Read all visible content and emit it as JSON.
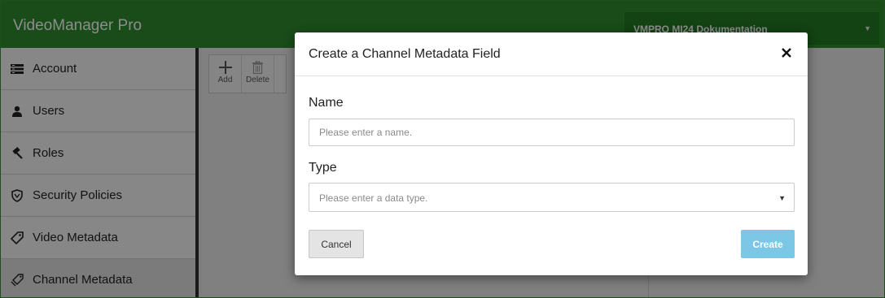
{
  "header": {
    "app_title": "VideoManager Pro",
    "project_selector": "VMPRO MI24 Dokumentation"
  },
  "sidebar": {
    "items": [
      {
        "label": "Account",
        "icon": "list-icon"
      },
      {
        "label": "Users",
        "icon": "user-icon"
      },
      {
        "label": "Roles",
        "icon": "gavel-icon"
      },
      {
        "label": "Security Policies",
        "icon": "shield-icon"
      },
      {
        "label": "Video Metadata",
        "icon": "tag-icon"
      },
      {
        "label": "Channel Metadata",
        "icon": "tags-icon"
      }
    ],
    "active_index": 5
  },
  "toolbar": {
    "add_label": "Add",
    "delete_label": "Delete"
  },
  "modal": {
    "title": "Create a Channel Metadata Field",
    "name_label": "Name",
    "name_placeholder": "Please enter a name.",
    "name_value": "",
    "type_label": "Type",
    "type_placeholder": "Please enter a data type.",
    "cancel_label": "Cancel",
    "create_label": "Create"
  },
  "colors": {
    "header": "#2e8b2e",
    "create_button": "#7cc6e6",
    "overlay": "rgba(0,0,0,0.45)"
  }
}
